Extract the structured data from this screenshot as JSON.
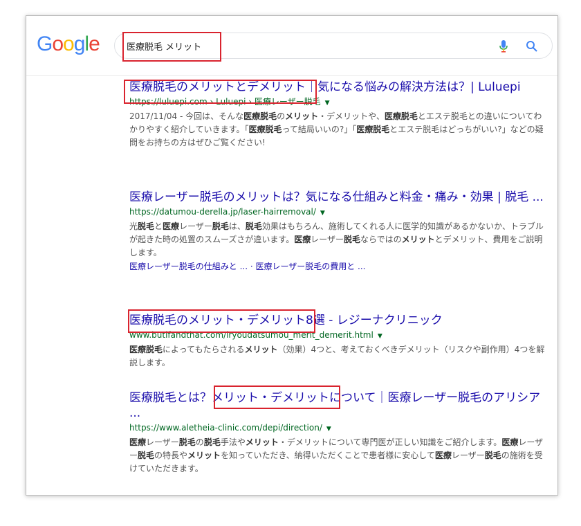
{
  "logo": {
    "letters": [
      "G",
      "o",
      "o",
      "g",
      "l",
      "e"
    ],
    "colors": [
      "#4285f4",
      "#ea4335",
      "#fbbc05",
      "#4285f4",
      "#34a853",
      "#ea4335"
    ]
  },
  "search": {
    "query": "医療脱毛 メリット"
  },
  "icons": {
    "mic": "mic-icon",
    "search": "search-icon"
  },
  "results": [
    {
      "title": "医療脱毛のメリットとデメリット｜気になる悩みの解決方法は？| Luluepi",
      "url": "https://luluepi.com › Luluepi › 医療レーザー脱毛",
      "snippet_html": "2017/11/04 - 今回は、そんな<b>医療脱毛</b>の<b>メリット</b>・デメリットや、<b>医療脱毛</b>とエステ脱毛との違いについてわかりやすく紹介していきます。「<b>医療脱毛</b>って結局いいの?」「<b>医療脱毛</b>とエステ脱毛はどっちがいい?」などの疑問をお持ちの方はぜひご覧ください!"
    },
    {
      "title": "医療レーザー脱毛のメリットは？気になる仕組みと料金・痛み・効果 | 脱毛 ...",
      "url": "https://datumou-derella.jp/laser-hairremoval/",
      "snippet_html": "光<b>脱毛</b>と<b>医療</b>レーザー<b>脱毛</b>は、<b>脱毛</b>効果はもちろん、施術してくれる人に医学的知識があるかないか、トラブルが起きた時の処置のスムーズさが違います。<b>医療</b>レーザー<b>脱毛</b>ならではの<b>メリット</b>とデメリット、費用をご説明します。",
      "sitelinks": "医療レーザー脱毛の仕組みと ... · 医療レーザー脱毛の費用と ..."
    },
    {
      "title": "医療脱毛のメリット・デメリット8選 - レジーナクリニック",
      "url": "www.butifandthat.com/iryoudatsumou_merit_demerit.html",
      "snippet_html": "<b>医療脱毛</b>によってもたらされる<b>メリット</b>（効果）4つと、考えておくべきデメリット（リスクや副作用）4つを解説します。"
    },
    {
      "title": "医療脱毛とは？メリット・デメリットについて｜医療レーザー脱毛のアリシア ...",
      "url": "https://www.aletheia-clinic.com/depi/direction/",
      "snippet_html": "<b>医療</b>レーザー<b>脱毛</b>の<b>脱毛</b>手法や<b>メリット</b>・デメリットについて専門医が正しい知識をご紹介します。<b>医療</b>レーザー<b>脱毛</b>の特長や<b>メリット</b>を知っていただき、納得いただくことで患者様に安心して<b>医療</b>レーザー<b>脱毛</b>の施術を受けていただきます。"
    }
  ]
}
